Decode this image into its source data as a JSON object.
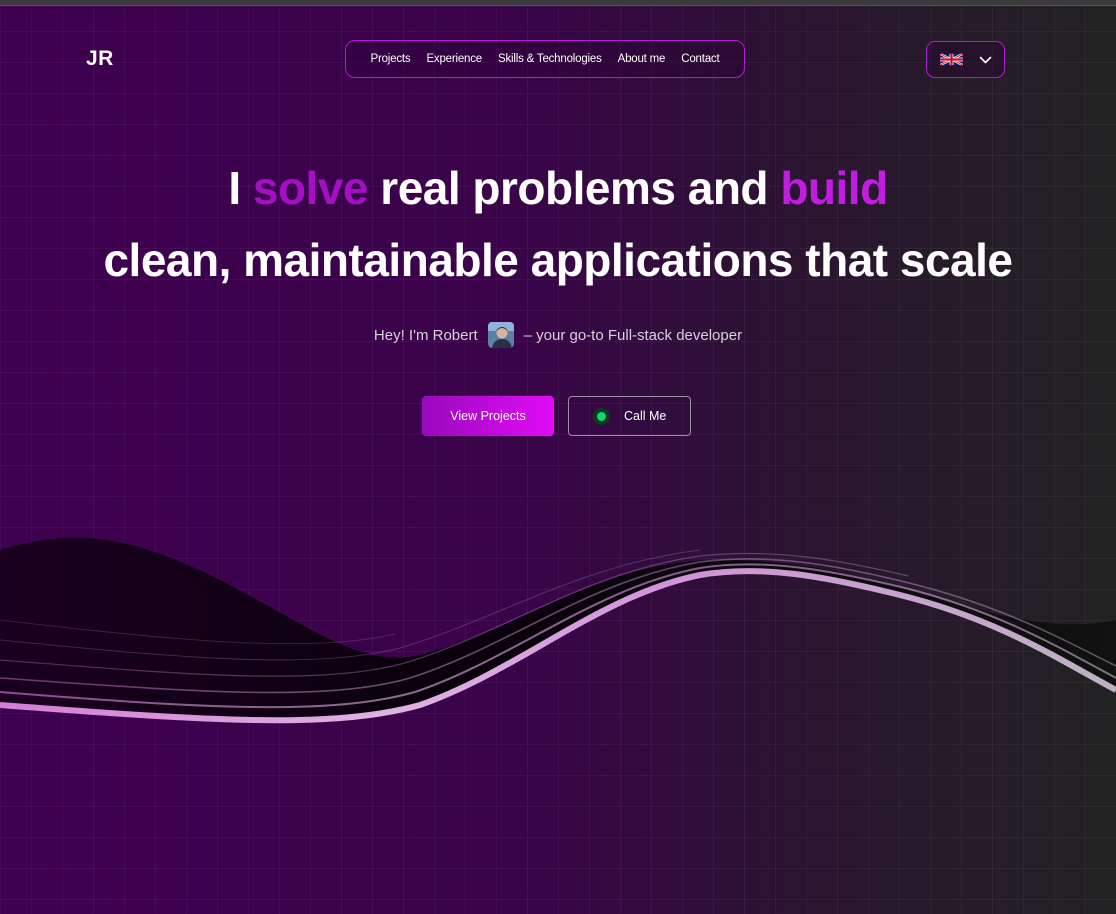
{
  "header": {
    "logo": "JR",
    "nav": [
      {
        "label": "Projects"
      },
      {
        "label": "Experience"
      },
      {
        "label": "Skills & Technologies"
      },
      {
        "label": "About me"
      },
      {
        "label": "Contact"
      }
    ],
    "language": {
      "selected_icon": "uk-flag-icon",
      "dropdown_icon": "chevron-down-icon"
    }
  },
  "hero": {
    "line1": {
      "w1": "I",
      "w2": "solve",
      "w3": "real problems and",
      "w4": "build"
    },
    "line2": "clean, maintainable applications that scale",
    "intro_before": "Hey! I'm Robert",
    "intro_after": "– your go-to Full-stack developer",
    "primary_button": "View Projects",
    "secondary_button": "Call Me"
  },
  "colors": {
    "accent_purple": "#a50fc4",
    "accent_magenta": "#c21ce0",
    "button_gradient_start": "#9a09bd",
    "button_gradient_end": "#e10cf6",
    "status_green": "#13d66d",
    "background_left": "#3e0050",
    "background_right": "#222222"
  }
}
